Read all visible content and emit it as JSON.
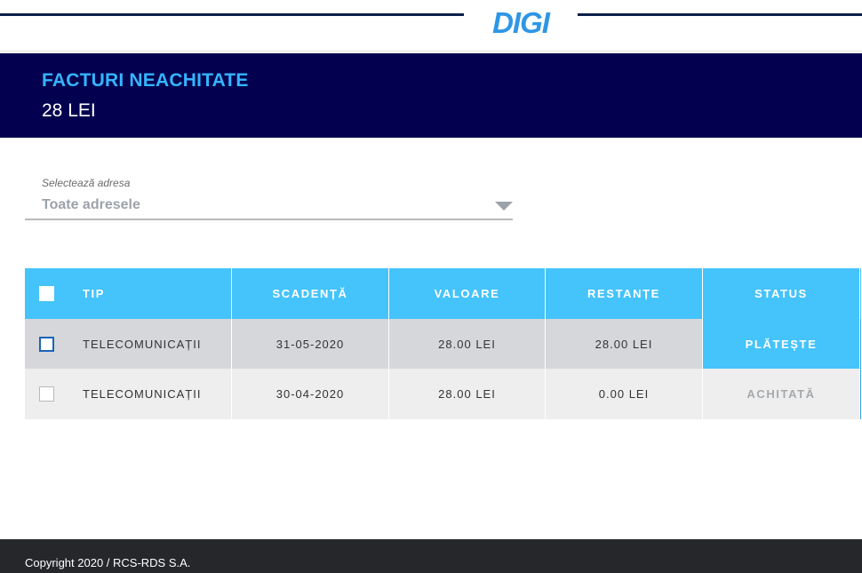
{
  "brand": {
    "logo_text": "DIGI",
    "colors": {
      "navy": "#03004f",
      "accent": "#45c3fb",
      "title_blue": "#35b5ff",
      "footer": "#26272b"
    }
  },
  "header": {
    "title": "FACTURI NEACHITATE",
    "amount": "28 LEI"
  },
  "address_select": {
    "label": "Selectează adresa",
    "value": "Toate adresele",
    "icon": "chevron-down-icon"
  },
  "table": {
    "columns": [
      "TIP",
      "SCADENȚĂ",
      "VALOARE",
      "RESTANȚE",
      "STATUS"
    ],
    "rows": [
      {
        "tip": "TELECOMUNICAȚII",
        "scadenta": "31-05-2020",
        "valoare": "28.00 LEI",
        "restante": "28.00 LEI",
        "status": "PLĂTEȘTE"
      },
      {
        "tip": "TELECOMUNICAȚII",
        "scadenta": "30-04-2020",
        "valoare": "28.00 LEI",
        "restante": "0.00 LEI",
        "status": "ACHITATĂ"
      }
    ]
  },
  "footer": {
    "copyright": "Copyright 2020 / RCS-RDS S.A."
  }
}
